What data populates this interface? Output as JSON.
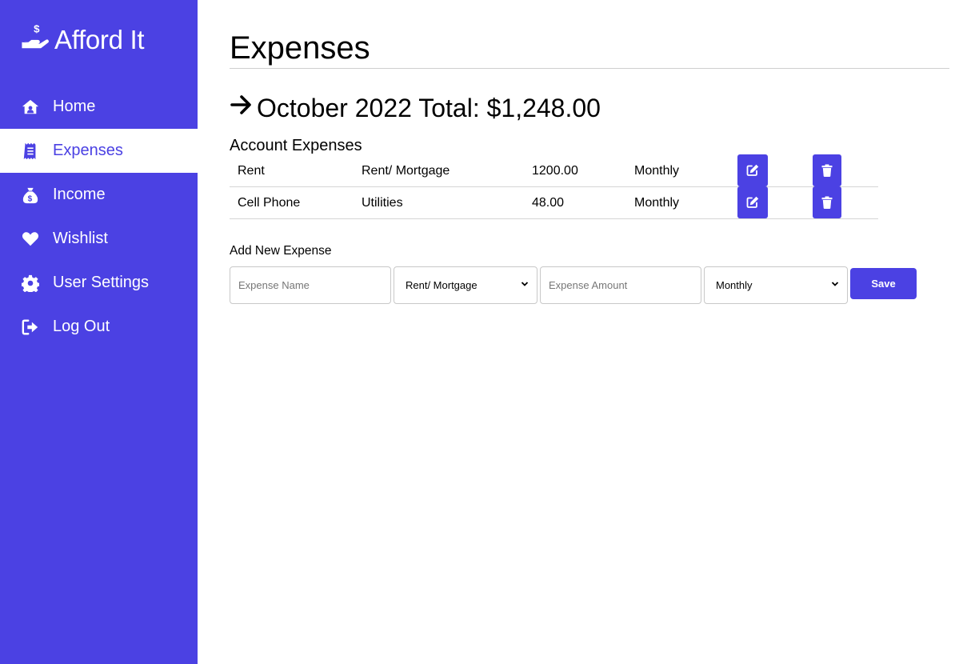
{
  "app": {
    "name": "Afford It"
  },
  "sidebar": {
    "items": [
      {
        "label": "Home",
        "icon": "home-icon",
        "active": false
      },
      {
        "label": "Expenses",
        "icon": "receipt-icon",
        "active": true
      },
      {
        "label": "Income",
        "icon": "money-bag-icon",
        "active": false
      },
      {
        "label": "Wishlist",
        "icon": "heart-icon",
        "active": false
      },
      {
        "label": "User Settings",
        "icon": "gear-icon",
        "active": false
      },
      {
        "label": "Log Out",
        "icon": "logout-icon",
        "active": false
      }
    ]
  },
  "page": {
    "title": "Expenses",
    "total_text": "October 2022 Total: $1,248.00",
    "account_heading": "Account Expenses"
  },
  "expenses": [
    {
      "name": "Rent",
      "category": "Rent/ Mortgage",
      "amount": "1200.00",
      "frequency": "Monthly"
    },
    {
      "name": "Cell Phone",
      "category": "Utilities",
      "amount": "48.00",
      "frequency": "Monthly"
    }
  ],
  "add_form": {
    "heading": "Add New Expense",
    "name_placeholder": "Expense Name",
    "category_selected": "Rent/ Mortgage",
    "amount_placeholder": "Expense Amount",
    "frequency_selected": "Monthly",
    "save_label": "Save"
  },
  "colors": {
    "accent": "#4b41e3",
    "background": "#ffffff",
    "divider": "#d6d6d6"
  }
}
